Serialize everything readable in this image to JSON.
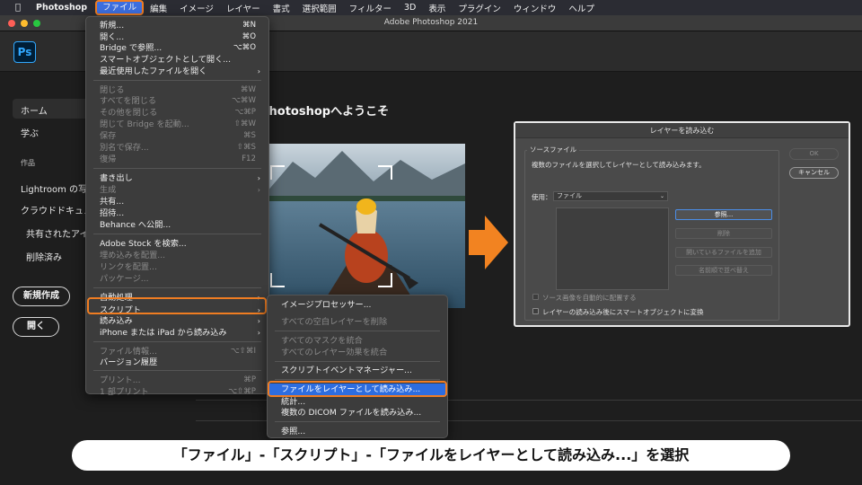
{
  "menubar": {
    "app_name": "Photoshop",
    "items": [
      "ファイル",
      "編集",
      "イメージ",
      "レイヤー",
      "書式",
      "選択範囲",
      "フィルター",
      "3D",
      "表示",
      "プラグイン",
      "ウィンドウ",
      "ヘルプ"
    ]
  },
  "window": {
    "title": "Adobe Photoshop 2021"
  },
  "app": {
    "logo_text": "Ps"
  },
  "sidebar": {
    "home": "ホーム",
    "learn": "学ぶ",
    "files_heading": "作品",
    "lightroom": "Lightroom の写真",
    "cloud_docs": "クラウドドキュメント",
    "shared": "共有されたアイテム",
    "deleted": "削除済み",
    "new_button": "新規作成",
    "open_button": "開く"
  },
  "welcome": {
    "title": "Photoshopへようこそ"
  },
  "file_menu": {
    "items": [
      {
        "label": "新規...",
        "shortcut": "⌘N",
        "disabled": false
      },
      {
        "label": "開く...",
        "shortcut": "⌘O",
        "disabled": false
      },
      {
        "label": "Bridge で参照...",
        "shortcut": "⌥⌘O",
        "disabled": false
      },
      {
        "label": "スマートオブジェクトとして開く...",
        "shortcut": "",
        "disabled": false
      },
      {
        "label": "最近使用したファイルを開く",
        "shortcut": "",
        "disabled": false,
        "submenu": true
      },
      {
        "label": "閉じる",
        "shortcut": "⌘W",
        "disabled": true
      },
      {
        "label": "すべてを閉じる",
        "shortcut": "⌥⌘W",
        "disabled": true
      },
      {
        "label": "その他を閉じる",
        "shortcut": "⌥⌘P",
        "disabled": true
      },
      {
        "label": "閉じて Bridge を起動...",
        "shortcut": "⇧⌘W",
        "disabled": true
      },
      {
        "label": "保存",
        "shortcut": "⌘S",
        "disabled": true
      },
      {
        "label": "別名で保存...",
        "shortcut": "⇧⌘S",
        "disabled": true
      },
      {
        "label": "復帰",
        "shortcut": "F12",
        "disabled": true
      },
      {
        "label": "書き出し",
        "shortcut": "",
        "disabled": false,
        "submenu": true
      },
      {
        "label": "生成",
        "shortcut": "",
        "disabled": true,
        "submenu": true
      },
      {
        "label": "共有...",
        "shortcut": "",
        "disabled": false
      },
      {
        "label": "招待...",
        "shortcut": "",
        "disabled": false
      },
      {
        "label": "Behance へ公開...",
        "shortcut": "",
        "disabled": false
      },
      {
        "label": "Adobe Stock を検索...",
        "shortcut": "",
        "disabled": false
      },
      {
        "label": "埋め込みを配置...",
        "shortcut": "",
        "disabled": true
      },
      {
        "label": "リンクを配置...",
        "shortcut": "",
        "disabled": true
      },
      {
        "label": "パッケージ...",
        "shortcut": "",
        "disabled": true
      },
      {
        "label": "自動処理",
        "shortcut": "",
        "disabled": false,
        "submenu": true
      },
      {
        "label": "スクリプト",
        "shortcut": "",
        "disabled": false,
        "submenu": true
      },
      {
        "label": "読み込み",
        "shortcut": "",
        "disabled": false,
        "submenu": true
      },
      {
        "label": "iPhone または iPad から読み込み",
        "shortcut": "",
        "disabled": false,
        "submenu": true
      },
      {
        "label": "ファイル情報...",
        "shortcut": "⌥⇧⌘I",
        "disabled": true
      },
      {
        "label": "バージョン履歴",
        "shortcut": "",
        "disabled": false
      },
      {
        "label": "プリント...",
        "shortcut": "⌘P",
        "disabled": true
      },
      {
        "label": "1 部プリント",
        "shortcut": "⌥⇧⌘P",
        "disabled": true
      }
    ]
  },
  "script_submenu": {
    "items": [
      {
        "label": "イメージプロセッサー...",
        "disabled": false
      },
      {
        "label": "すべての空白レイヤーを削除",
        "disabled": true
      },
      {
        "label": "すべてのマスクを統合",
        "disabled": true
      },
      {
        "label": "すべてのレイヤー効果を統合",
        "disabled": true
      },
      {
        "label": "スクリプトイベントマネージャー...",
        "disabled": false
      },
      {
        "label": "ファイルをレイヤーとして読み込み...",
        "disabled": false,
        "selected": true
      },
      {
        "label": "統計...",
        "disabled": false
      },
      {
        "label": "複数の DICOM ファイルを読み込み...",
        "disabled": false
      },
      {
        "label": "参照...",
        "disabled": false
      }
    ]
  },
  "dialog": {
    "title": "レイヤーを読み込む",
    "group_title": "ソースファイル",
    "description": "複数のファイルを選択してレイヤーとして読み込みます。",
    "use_label": "使用：",
    "use_value": "ファイル",
    "browse_button": "参照...",
    "remove_button": "削除",
    "add_open_button": "開いているファイルを追加",
    "sort_button": "名前順で並べ替え",
    "ok_button": "OK",
    "cancel_button": "キャンセル",
    "auto_align_label": "ソース画像を自動的に配置する",
    "smart_object_label": "レイヤーの読み込み後にスマートオブジェクトに変換"
  },
  "caption": {
    "text": "「ファイル」-「スクリプト」-「ファイルをレイヤーとして読み込み...」を選択"
  },
  "colors": {
    "highlight": "#f07d22",
    "selection": "#2d6de0",
    "arrow": "#f28321"
  }
}
